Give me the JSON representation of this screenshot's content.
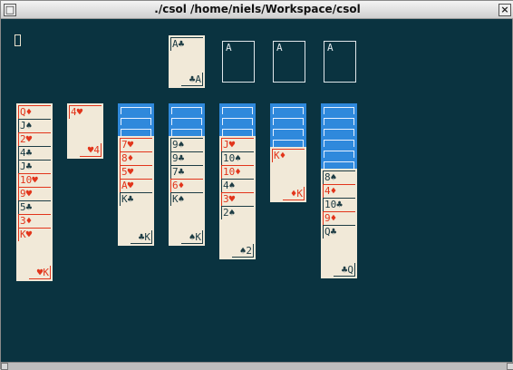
{
  "window": {
    "title": "./csol  /home/niels/Workspace/csol",
    "menu_glyph": "□",
    "close_glyph": "×"
  },
  "colors": {
    "background": "#0a3340",
    "card_face": "#f1e9d8",
    "card_back": "#2f89dc",
    "red_suit": "#e2351b",
    "black_suit": "#1d3c44"
  },
  "icons": {
    "terminal-cursor": "empty block cursor",
    "card-back": "blue striped card back"
  },
  "stock": {
    "label": "A",
    "top_left": "A♣",
    "bottom_right": "♣A"
  },
  "foundations": [
    {
      "label": "A"
    },
    {
      "label": "A"
    },
    {
      "label": "A"
    }
  ],
  "tableau": [
    {
      "hidden": 0,
      "cards": [
        "Q♦",
        "J♠",
        "2♥",
        "4♣",
        "J♣",
        "10♥",
        "9♥",
        "5♣",
        "3♦",
        "K♥"
      ],
      "bottom": "♥K"
    },
    {
      "hidden": 0,
      "cards": [
        "4♥"
      ],
      "bottom": "♥4"
    },
    {
      "hidden": 3,
      "cards": [
        "7♥",
        "8♦",
        "5♥",
        "A♥",
        "K♣"
      ],
      "bottom": "♣K"
    },
    {
      "hidden": 3,
      "cards": [
        "9♠",
        "9♣",
        "7♣",
        "6♦",
        "K♠"
      ],
      "bottom": "♠K"
    },
    {
      "hidden": 3,
      "cards": [
        "J♥",
        "10♠",
        "10♦",
        "4♠",
        "3♥",
        "2♠"
      ],
      "bottom": "♠2"
    },
    {
      "hidden": 4,
      "cards": [
        "K♦"
      ],
      "bottom": "♦K"
    },
    {
      "hidden": 6,
      "cards": [
        "8♠",
        "4♦",
        "10♣",
        "9♦",
        "Q♣"
      ],
      "bottom": "♣Q"
    }
  ]
}
